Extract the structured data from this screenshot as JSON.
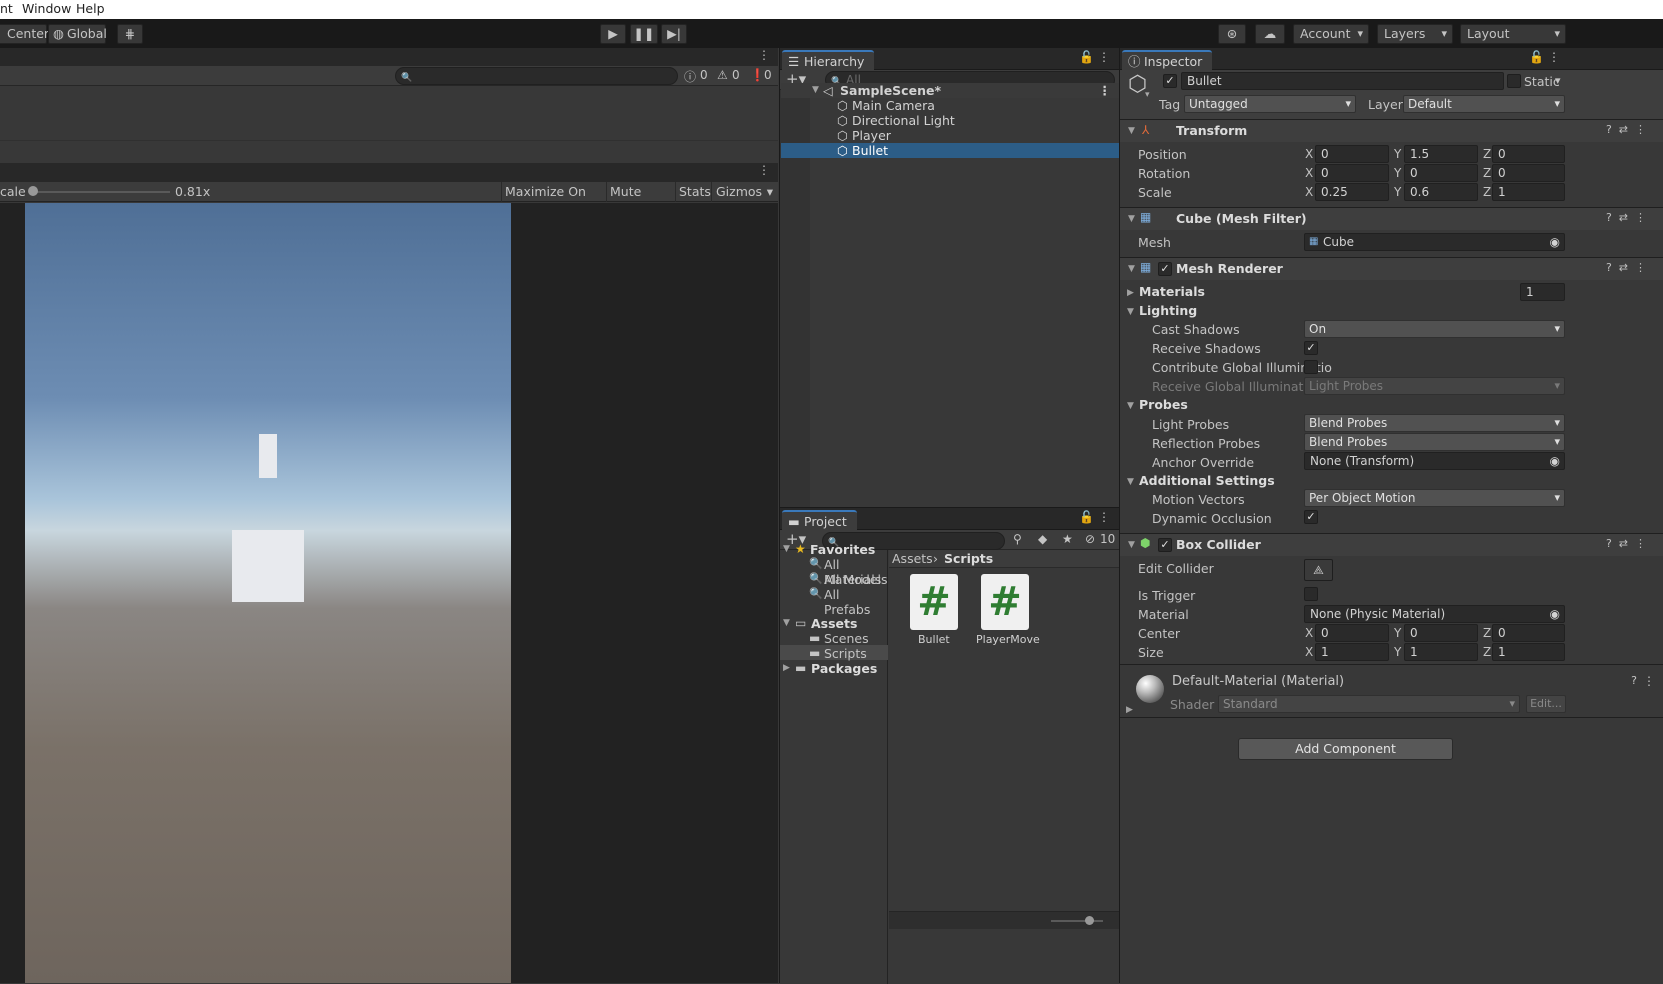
{
  "menu": [
    "nt",
    "Window",
    "Help"
  ],
  "toolbar": {
    "center": "Center",
    "global": "Global",
    "account": "Account",
    "layers": "Layers",
    "layout": "Layout"
  },
  "console": {
    "errors": "0",
    "warnings": "0",
    "messages": "0"
  },
  "game": {
    "scale_label": "cale",
    "scale_value": "0.81x",
    "maximize": "Maximize On Play",
    "mute": "Mute Audio",
    "stats": "Stats",
    "gizmos": "Gizmos"
  },
  "hierarchy": {
    "tab": "Hierarchy",
    "search_placeholder": "All",
    "scene": "SampleScene*",
    "items": [
      "Main Camera",
      "Directional Light",
      "Player",
      "Bullet"
    ]
  },
  "project": {
    "tab": "Project",
    "hidden_count": "10",
    "favorites": "Favorites",
    "favorites_items": [
      "All Materials",
      "All Models",
      "All Prefabs"
    ],
    "assets": "Assets",
    "assets_items": [
      "Scenes",
      "Scripts"
    ],
    "packages": "Packages",
    "breadcrumb": [
      "Assets",
      "Scripts"
    ],
    "files": [
      "Bullet",
      "PlayerMove"
    ]
  },
  "inspector": {
    "tab": "Inspector",
    "object_name": "Bullet",
    "static": "Static",
    "tag_label": "Tag",
    "tag": "Untagged",
    "layer_label": "Layer",
    "layer": "Default",
    "transform": {
      "title": "Transform",
      "position_label": "Position",
      "position": [
        "0",
        "1.5",
        "0"
      ],
      "rotation_label": "Rotation",
      "rotation": [
        "0",
        "0",
        "0"
      ],
      "scale_label": "Scale",
      "scale": [
        "0.25",
        "0.6",
        "1"
      ]
    },
    "mesh_filter": {
      "title": "Cube (Mesh Filter)",
      "mesh_label": "Mesh",
      "mesh": "Cube"
    },
    "mesh_renderer": {
      "title": "Mesh Renderer",
      "materials_label": "Materials",
      "materials_count": "1",
      "lighting": "Lighting",
      "cast_shadows_label": "Cast Shadows",
      "cast_shadows": "On",
      "receive_shadows_label": "Receive Shadows",
      "contribute_gi_label": "Contribute Global Illuminatio",
      "receive_gi_label": "Receive Global Illumination",
      "receive_gi": "Light Probes",
      "probes": "Probes",
      "light_probes_label": "Light Probes",
      "light_probes": "Blend Probes",
      "reflection_probes_label": "Reflection Probes",
      "reflection_probes": "Blend Probes",
      "anchor_override_label": "Anchor Override",
      "anchor_override": "None (Transform)",
      "additional": "Additional Settings",
      "motion_vectors_label": "Motion Vectors",
      "motion_vectors": "Per Object Motion",
      "dynamic_occlusion_label": "Dynamic Occlusion"
    },
    "box_collider": {
      "title": "Box Collider",
      "edit_label": "Edit Collider",
      "trigger_label": "Is Trigger",
      "material_label": "Material",
      "material": "None (Physic Material)",
      "center_label": "Center",
      "center": [
        "0",
        "0",
        "0"
      ],
      "size_label": "Size",
      "size": [
        "1",
        "1",
        "1"
      ]
    },
    "material": {
      "title": "Default-Material (Material)",
      "shader_label": "Shader",
      "shader": "Standard",
      "edit": "Edit..."
    },
    "add_component": "Add Component"
  },
  "axes": [
    "X",
    "Y",
    "Z"
  ]
}
